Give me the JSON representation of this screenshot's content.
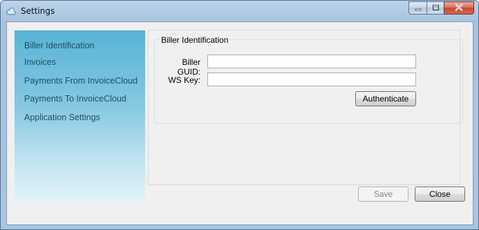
{
  "window": {
    "title": "Settings",
    "app_icon": "cloud-icon"
  },
  "caption_buttons": {
    "minimize_icon": "minimize-icon",
    "maximize_icon": "maximize-icon",
    "close_icon": "close-icon"
  },
  "nav": {
    "items": [
      {
        "label": "Biller Identification"
      },
      {
        "label": "Invoices"
      },
      {
        "label": "Payments From InvoiceCloud"
      },
      {
        "label": "Payments To InvoiceCloud"
      },
      {
        "label": "Application Settings"
      }
    ]
  },
  "biller_identification": {
    "group_title": "Biller Identification",
    "biller_guid_label": "Biller GUID:",
    "biller_guid_value": "",
    "ws_key_label": "WS Key:",
    "ws_key_value": "",
    "authenticate_label": "Authenticate"
  },
  "footer": {
    "save_label": "Save",
    "save_enabled": false,
    "close_label": "Close"
  }
}
